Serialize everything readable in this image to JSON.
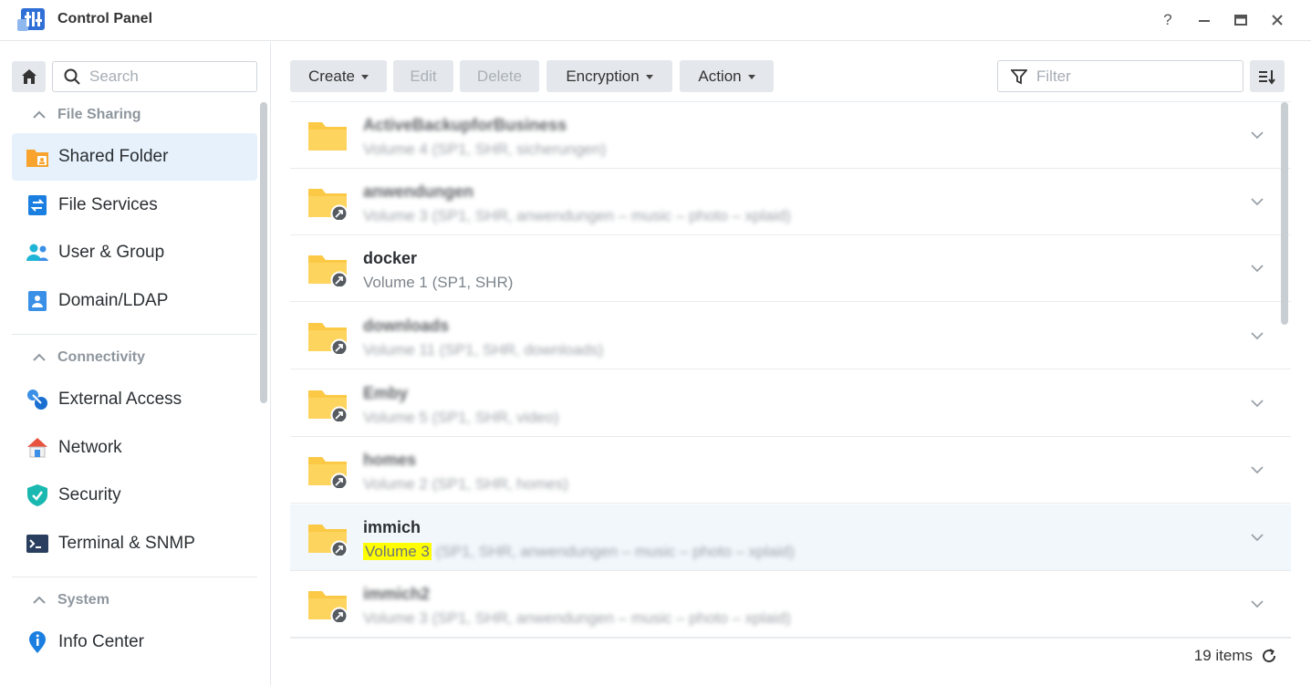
{
  "window": {
    "title": "Control Panel",
    "help": "?",
    "minimize": "—",
    "maximize": "▣",
    "close": "✕"
  },
  "sidebar": {
    "search_placeholder": "Search",
    "sections": [
      {
        "title": "File Sharing",
        "items": [
          {
            "label": "Shared Folder",
            "icon": "shared-folder-icon",
            "active": true
          },
          {
            "label": "File Services",
            "icon": "file-services-icon"
          },
          {
            "label": "User & Group",
            "icon": "user-group-icon"
          },
          {
            "label": "Domain/LDAP",
            "icon": "domain-ldap-icon"
          }
        ]
      },
      {
        "title": "Connectivity",
        "items": [
          {
            "label": "External Access",
            "icon": "external-access-icon"
          },
          {
            "label": "Network",
            "icon": "network-icon"
          },
          {
            "label": "Security",
            "icon": "security-shield-icon"
          },
          {
            "label": "Terminal & SNMP",
            "icon": "terminal-icon"
          }
        ]
      },
      {
        "title": "System",
        "items": [
          {
            "label": "Info Center",
            "icon": "info-center-icon"
          }
        ]
      }
    ]
  },
  "toolbar": {
    "create": "Create",
    "edit": "Edit",
    "delete": "Delete",
    "encryption": "Encryption",
    "action": "Action",
    "filter_placeholder": "Filter"
  },
  "folders": [
    {
      "name": "ActiveBackupforBusiness",
      "desc": "Volume 4 (SP1, SHR, sicherungen)",
      "blurred": true,
      "shortcut": false
    },
    {
      "name": "anwendungen",
      "desc": "Volume 3 (SP1, SHR, anwendungen – music – photo – xplaid)",
      "blurred": true,
      "shortcut": true
    },
    {
      "name": "docker",
      "desc": "Volume 1 (SP1, SHR)",
      "blurred": false,
      "shortcut": true
    },
    {
      "name": "downloads",
      "desc": "Volume 11 (SP1, SHR, downloads)",
      "blurred": true,
      "shortcut": true
    },
    {
      "name": "Emby",
      "desc": "Volume 5 (SP1, SHR, video)",
      "blurred": true,
      "shortcut": true
    },
    {
      "name": "homes",
      "desc": "Volume 2 (SP1, SHR, homes)",
      "blurred": true,
      "shortcut": true
    },
    {
      "name": "immich",
      "desc_highlight": "Volume 3",
      "desc_rest": "(SP1, SHR, anwendungen – music – photo – xplaid)",
      "blurred": false,
      "shortcut": true,
      "selected": true
    },
    {
      "name": "immich2",
      "desc": "Volume 3 (SP1, SHR, anwendungen – music – photo – xplaid)",
      "blurred": true,
      "shortcut": true
    }
  ],
  "footer": {
    "count": "19 items"
  },
  "colors": {
    "accent": "#0086e5",
    "folder": "#fbc945",
    "active_bg": "#e6f1fb",
    "highlight": "#ffff00"
  }
}
